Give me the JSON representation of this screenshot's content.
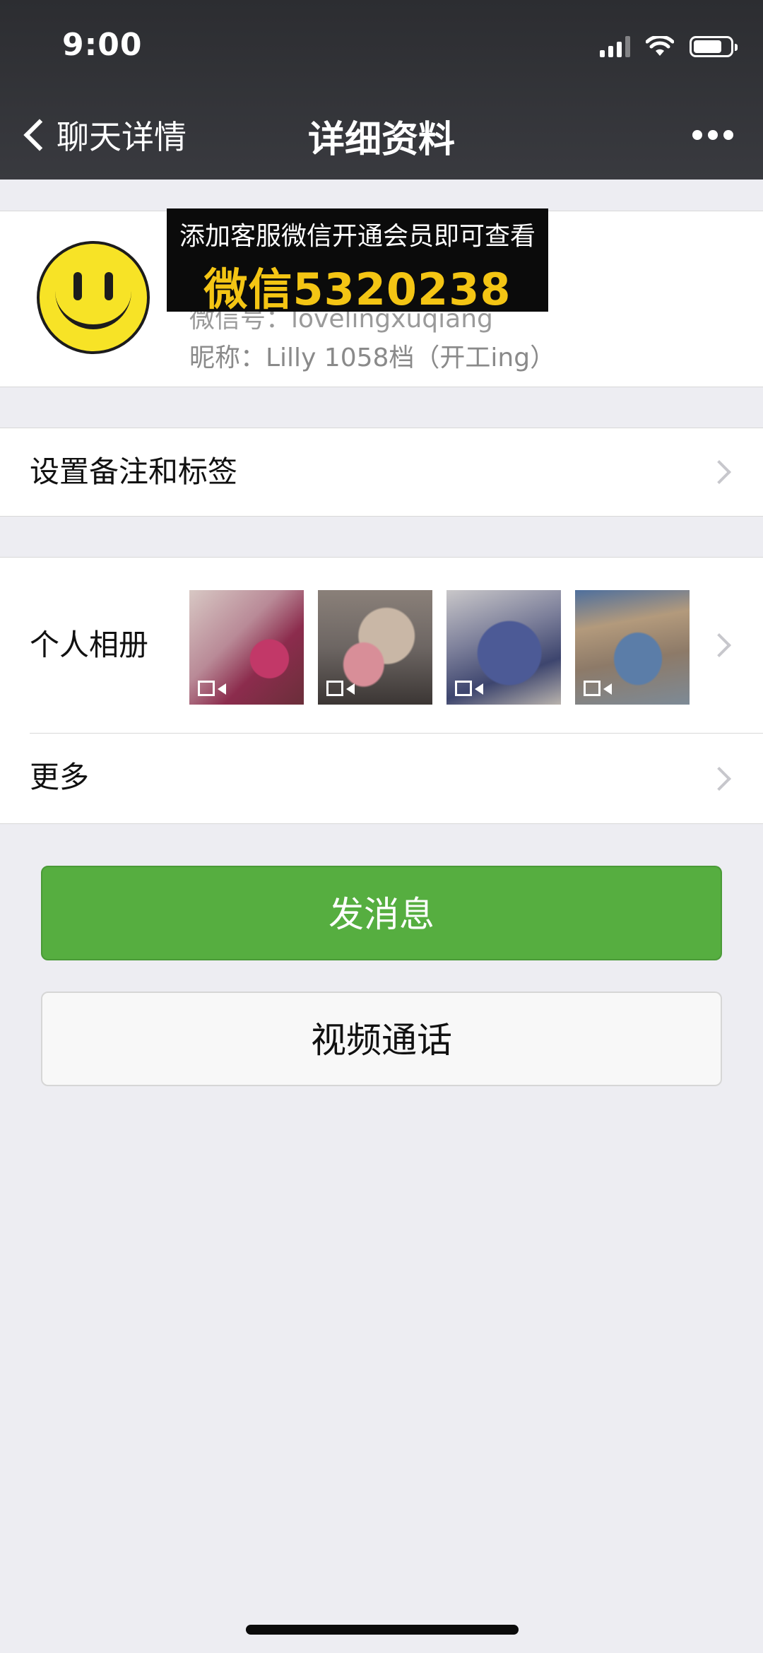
{
  "status_bar": {
    "time": "9:00"
  },
  "nav": {
    "back_label": "聊天详情",
    "title": "详细资料"
  },
  "profile": {
    "wechat_id_line": "微信号：lovelingxuqiang",
    "nickname_line": "昵称：Lilly 1058档（开工ing）"
  },
  "banner": {
    "line1": "添加客服微信开通会员即可查看",
    "line2": "微信5320238",
    "line2_color": "#f4c514"
  },
  "rows": {
    "remark_label": "设置备注和标签",
    "album_label": "个人相册",
    "more_label": "更多"
  },
  "album": {
    "thumbnails": [
      {
        "kind": "video",
        "subject": "pink glitter high heel"
      },
      {
        "kind": "video",
        "subject": "glitter pumps with bows"
      },
      {
        "kind": "video",
        "subject": "blue glitter high heel"
      },
      {
        "kind": "video",
        "subject": "blue pointed flats with bow"
      }
    ]
  },
  "buttons": {
    "send": "发消息",
    "video_call": "视频通话"
  },
  "colors": {
    "nav_bg": "#393a3f",
    "accent_green": "#56ae40",
    "page_bg": "#ededf2"
  }
}
